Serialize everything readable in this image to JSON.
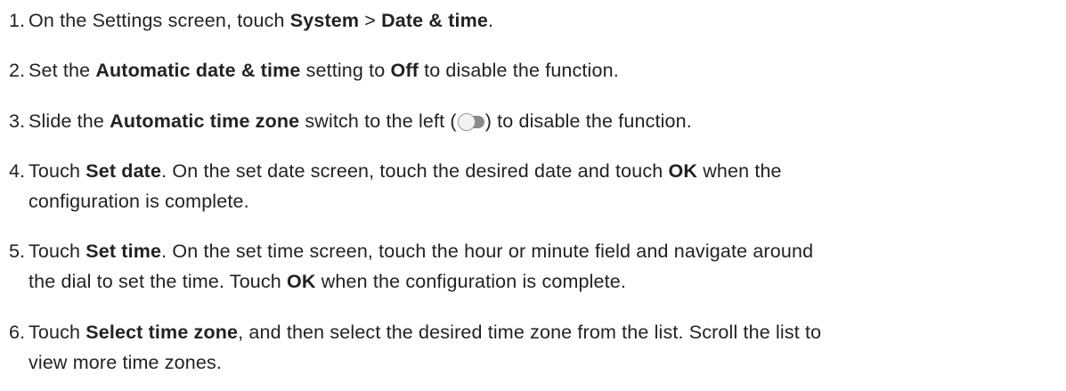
{
  "steps": [
    {
      "num": "1.",
      "t1": "On the Settings screen, touch ",
      "b1": "System",
      "t2": " > ",
      "b2": "Date & time",
      "t3": "."
    },
    {
      "num": "2.",
      "t1": "Set the ",
      "b1": "Automatic date & time",
      "t2": " setting to ",
      "b2": "Off",
      "t3": " to disable the function."
    },
    {
      "num": "3.",
      "t1": "Slide the ",
      "b1": "Automatic time zone",
      "t2": " switch to the left (",
      "icon": "toggle-switch-off-icon",
      "t3": ") to disable the function."
    },
    {
      "num": "4.",
      "t1": "Touch ",
      "b1": "Set date",
      "t2": ". On the set date screen, touch the desired date and touch ",
      "b2": "OK",
      "t3": " when the",
      "line2": "configuration is complete."
    },
    {
      "num": "5.",
      "t1": "Touch ",
      "b1": "Set time",
      "t2": ". On the set time screen, touch the hour or minute field and navigate around",
      "line2a": "the dial to set the time. Touch ",
      "b2": "OK",
      "line2b": " when the configuration is complete."
    },
    {
      "num": "6.",
      "t1": "Touch ",
      "b1": "Select time zone",
      "t2": ", and then select the desired time zone from the list. Scroll the list to",
      "line2": "view more time zones."
    }
  ]
}
